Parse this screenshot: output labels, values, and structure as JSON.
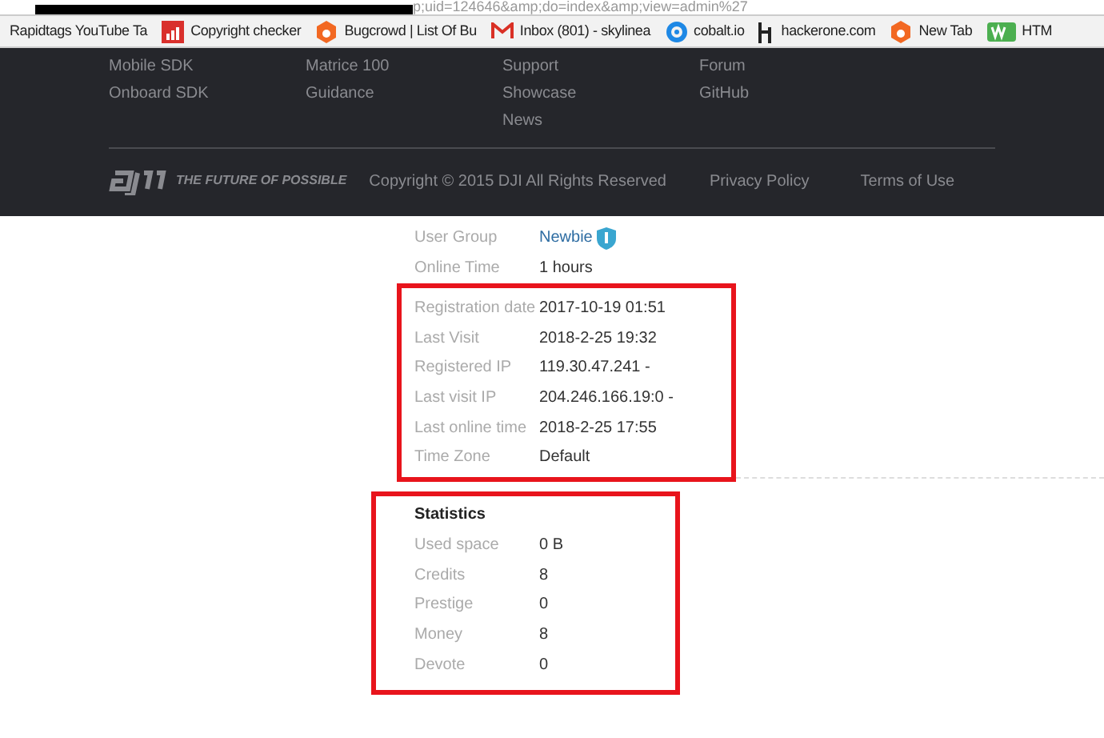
{
  "address_bar": {
    "url": "p;uid=124646&amp;do=index&amp;view=admin%27"
  },
  "bookmarks": [
    {
      "label": "Rapidtags YouTube Ta",
      "kind": "none"
    },
    {
      "label": "Copyright checker",
      "kind": "chart"
    },
    {
      "label": "Bugcrowd | List Of Bu",
      "kind": "b"
    },
    {
      "label": "Inbox (801) - skylinea",
      "kind": "mail"
    },
    {
      "label": "cobalt.io",
      "kind": "c"
    },
    {
      "label": "hackerone.com",
      "kind": "h1"
    },
    {
      "label": "New Tab",
      "kind": "b"
    },
    {
      "label": "HTM",
      "kind": "w3"
    }
  ],
  "footer": {
    "columns": [
      [
        "Mobile SDK",
        "Onboard SDK"
      ],
      [
        "Matrice 100",
        "Guidance"
      ],
      [
        "Support",
        "Showcase",
        "News"
      ],
      [
        "Forum",
        "GitHub"
      ]
    ],
    "tagline": "THE FUTURE OF POSSIBLE",
    "copyright": "Copyright © 2015 DJI All Rights Reserved",
    "links": [
      "Privacy Policy",
      "Terms of Use"
    ]
  },
  "profile": {
    "top_rows": [
      {
        "label": "User Group",
        "value": "Newbie",
        "kind": "badge"
      },
      {
        "label": "Online Time",
        "value": "1 hours",
        "kind": "text"
      }
    ],
    "highlighted": true,
    "rows": [
      {
        "label": "Registration date",
        "value": "2017-10-19 01:51"
      },
      {
        "label": "Last Visit",
        "value": "2018-2-25 19:32"
      },
      {
        "label": "Registered IP",
        "value": "119.30.47.241 -"
      },
      {
        "label": "Last visit IP",
        "value": "204.246.166.19:0 -"
      },
      {
        "label": "Last online time",
        "value": "2018-2-25 17:55"
      },
      {
        "label": "Time Zone",
        "value": "Default"
      }
    ]
  },
  "statistics": {
    "title": "Statistics",
    "highlighted": true,
    "rows": [
      {
        "label": "Used space",
        "value": "0 B"
      },
      {
        "label": "Credits",
        "value": "8"
      },
      {
        "label": "Prestige",
        "value": "0"
      },
      {
        "label": "Money",
        "value": "8"
      },
      {
        "label": "Devote",
        "value": "0"
      }
    ]
  }
}
